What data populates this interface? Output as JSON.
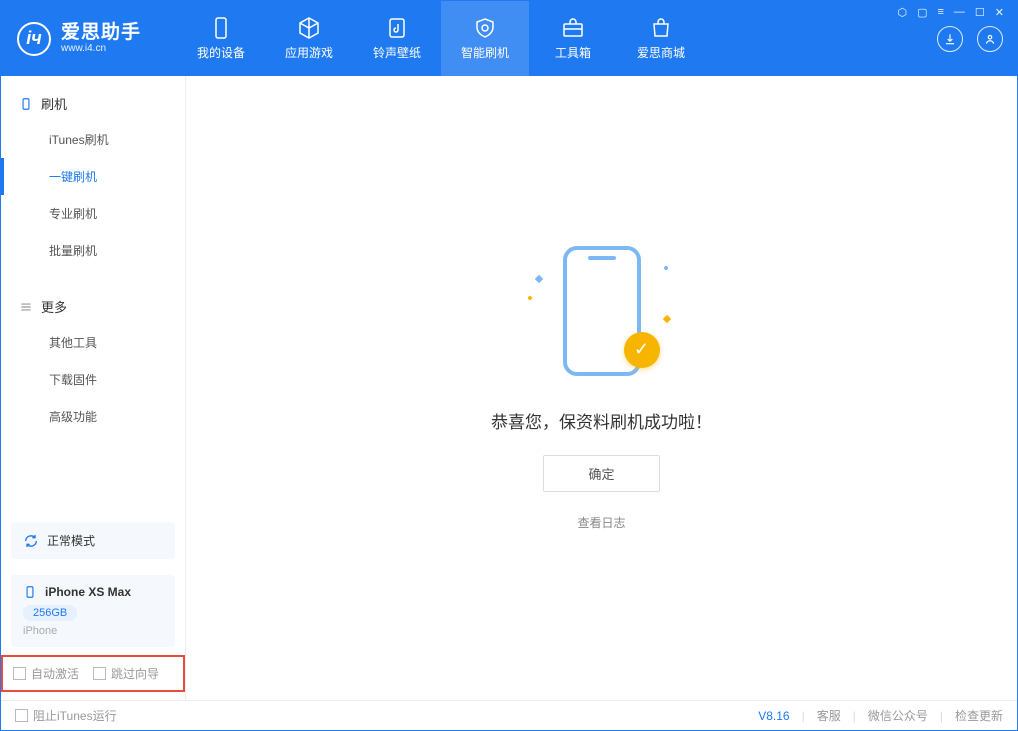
{
  "app": {
    "title": "爱思助手",
    "subtitle": "www.i4.cn"
  },
  "nav": {
    "tabs": [
      {
        "label": "我的设备"
      },
      {
        "label": "应用游戏"
      },
      {
        "label": "铃声壁纸"
      },
      {
        "label": "智能刷机"
      },
      {
        "label": "工具箱"
      },
      {
        "label": "爱思商城"
      }
    ]
  },
  "sidebar": {
    "section1": {
      "title": "刷机",
      "items": [
        "iTunes刷机",
        "一键刷机",
        "专业刷机",
        "批量刷机"
      ]
    },
    "section2": {
      "title": "更多",
      "items": [
        "其他工具",
        "下载固件",
        "高级功能"
      ]
    },
    "mode_label": "正常模式",
    "device": {
      "name": "iPhone XS Max",
      "capacity": "256GB",
      "type": "iPhone"
    },
    "cb1": "自动激活",
    "cb2": "跳过向导"
  },
  "main": {
    "success_text": "恭喜您，保资料刷机成功啦！",
    "ok_button": "确定",
    "log_link": "查看日志"
  },
  "footer": {
    "block_itunes": "阻止iTunes运行",
    "version": "V8.16",
    "links": [
      "客服",
      "微信公众号",
      "检查更新"
    ]
  }
}
